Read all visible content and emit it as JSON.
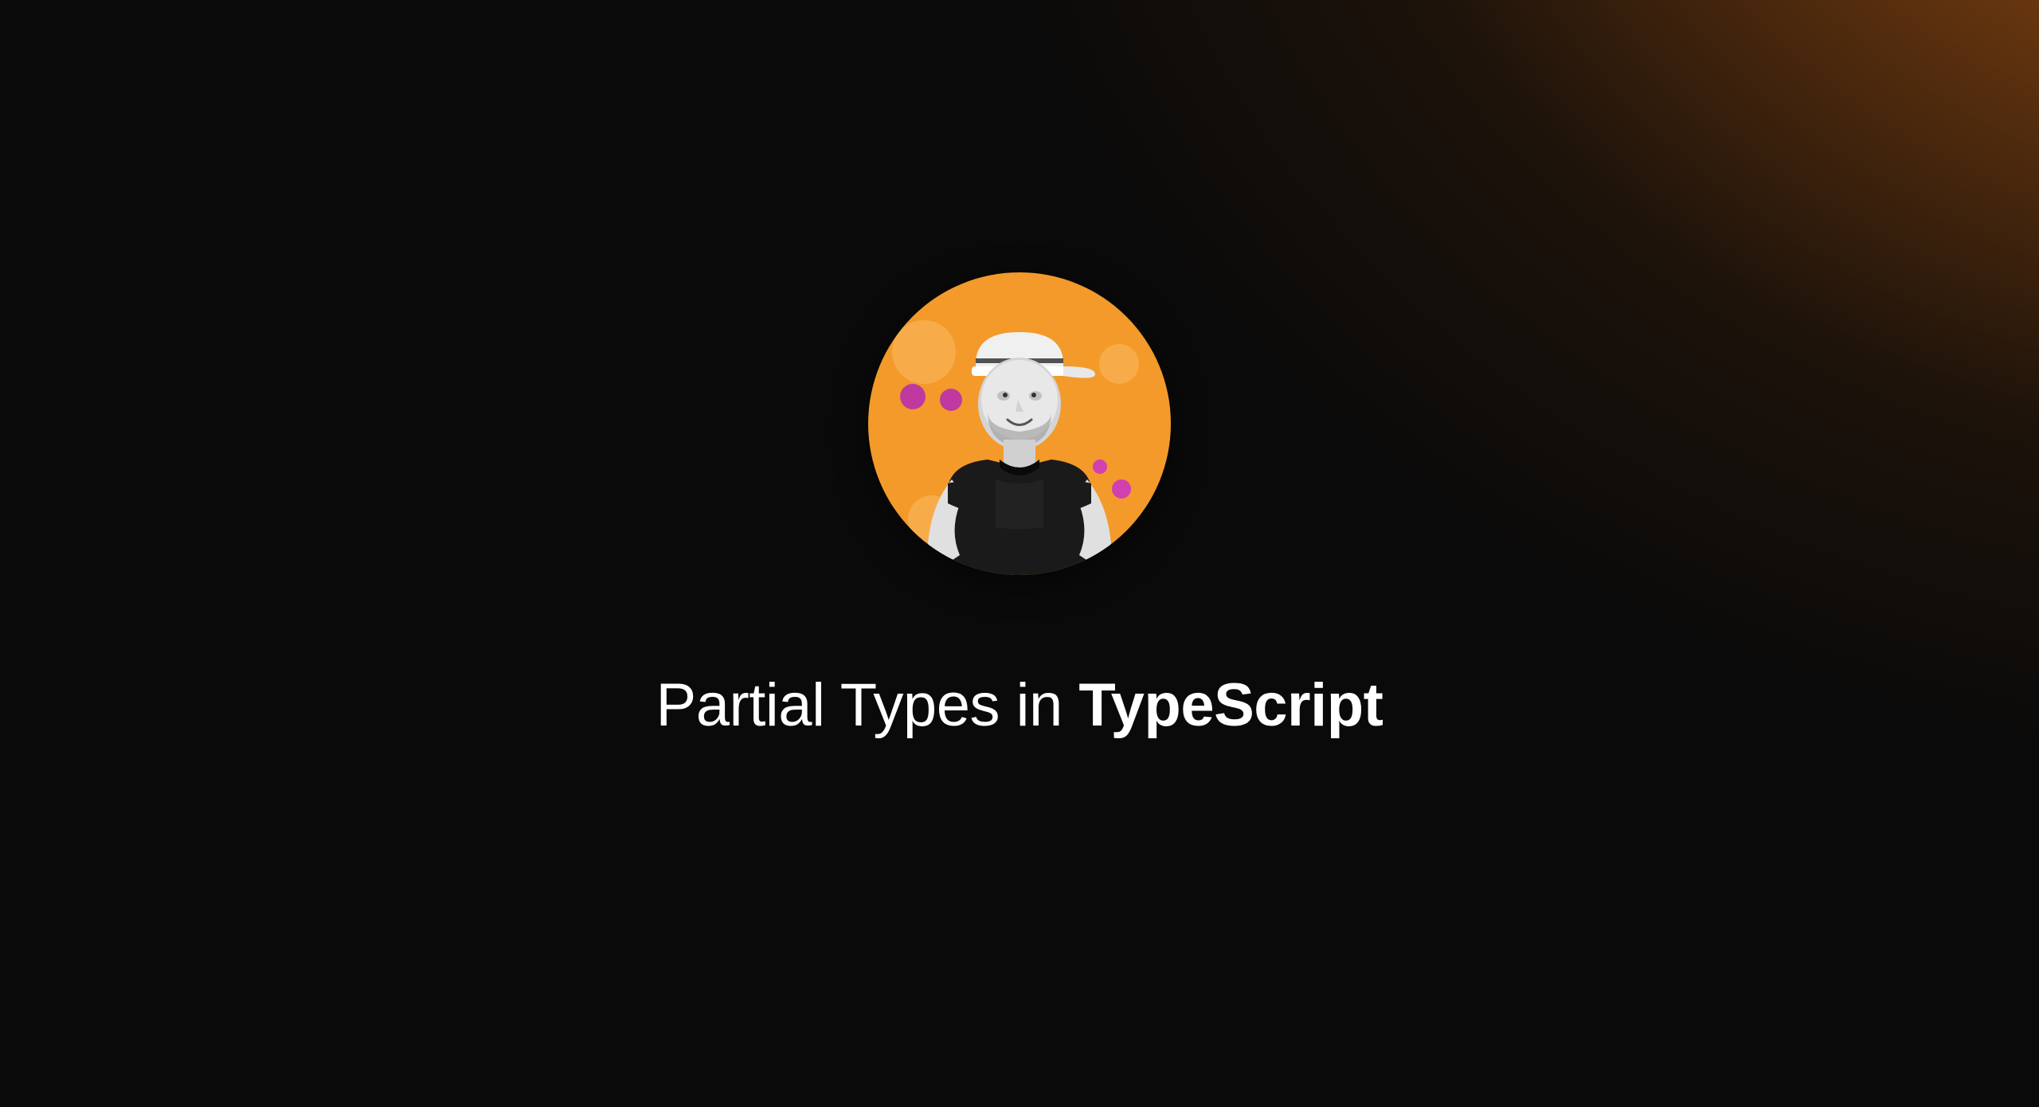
{
  "title": {
    "prefix": "Partial Types in ",
    "highlight": "TypeScript"
  },
  "avatar": {
    "name": "author-avatar",
    "background_color": "#f39a2a",
    "accent_dots_color": "#c039a0"
  }
}
